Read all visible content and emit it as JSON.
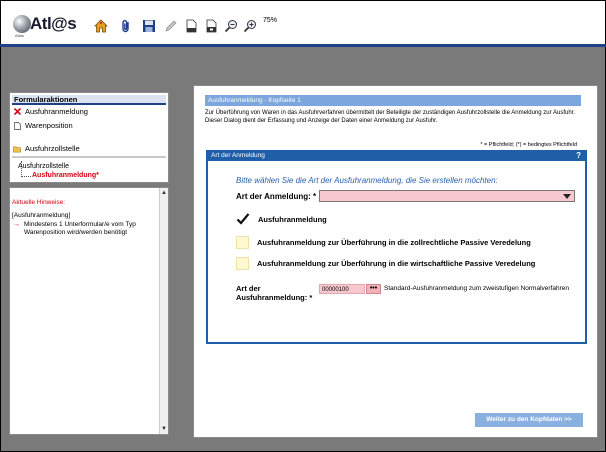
{
  "logo": {
    "text": "Atl@s",
    "sub": "Atlas"
  },
  "toolbar": {
    "zoom": "75%",
    "icons": [
      "home-icon",
      "paperclip-icon",
      "save-icon",
      "pencil-icon",
      "document-icon",
      "document-stack-icon",
      "zoom-out-icon",
      "zoom-in-icon"
    ]
  },
  "sidebar": {
    "section_title": "Formularaktionen",
    "items": [
      {
        "label": "Ausfuhranmeldung",
        "icon": "close-red-icon"
      },
      {
        "label": "Warenposition",
        "icon": "document-icon"
      },
      {
        "label": "Ausfuhrzollstelle",
        "icon": "folder-icon"
      }
    ],
    "tree": {
      "root": "Ausfuhrzollstelle",
      "child": "Ausfuhranmeldung*"
    }
  },
  "hints": {
    "title": "Aktuelle Hinweise:",
    "bracket": "[Ausfuhranmeldung]",
    "text": "Mindestens 1 Unterformular/e vom Typ Warenposition wird/werden benötigt"
  },
  "main": {
    "header": "Ausfuhranmeldung - Kopfseite 1",
    "intro": "Zur Überführung von Waren in das Ausfuhrverfahren übermittelt der Beteiligte der zuständigen Ausfuhrzollstelle die Anmeldung zur Ausfuhr. Dieser Dialog dient der Erfassung und Anzeige der Daten einer Anmeldung zur Ausfuhr.",
    "legend": "* = Pflichtfeld; (*) = bedingtes Pflichtfeld",
    "card": {
      "title": "Art der Anmeldung",
      "help": "?",
      "prompt": "Bitte wählen Sie die Art der Ausfuhranmeldung, die Sie erstellen möchten:",
      "art_label": "Art der Anmeldung: *",
      "art_value": "",
      "options": [
        {
          "label": "Ausfuhranmeldung",
          "checked": true
        },
        {
          "label": "Ausfuhranmeldung zur Überführung in die zollrechtliche Passive Veredelung",
          "checked": false
        },
        {
          "label": "Ausfuhranmeldung zur Überführung in die wirtschaftliche Passive Veredelung",
          "checked": false
        }
      ],
      "art2_label_line1": "Art der",
      "art2_label_line2": "Ausfuhranmeldung: *",
      "art2_value": "00000100",
      "art2_button": "•••",
      "art2_desc": "Standard-Ausfuhranmeldung zum zweistufigen Normalverfahren"
    },
    "next_button": "Weiter zu den Kopfdaten >>"
  },
  "colors": {
    "brand_blue": "#1f3f87",
    "card_blue": "#1f5fa8",
    "required_pink": "#f7c9cf",
    "error_red": "#d4000f"
  }
}
